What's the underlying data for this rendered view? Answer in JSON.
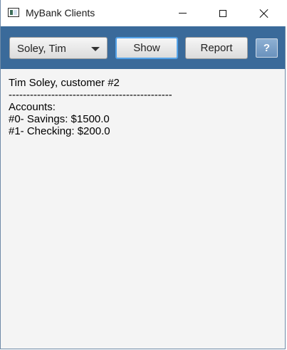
{
  "window": {
    "title": "MyBank Clients"
  },
  "toolbar": {
    "client_select_value": "Soley, Tim",
    "show_label": "Show",
    "report_label": "Report",
    "help_label": "?"
  },
  "content": {
    "lines": [
      "Tim Soley, customer #2",
      "-----------------------------------------------",
      "Accounts:",
      "#0- Savings: $1500.0",
      "#1- Checking: $200.0"
    ]
  },
  "colors": {
    "toolbar_bg": "#3a6a9a",
    "focus_border": "#55a3e8",
    "content_bg": "#f4f4f4"
  }
}
